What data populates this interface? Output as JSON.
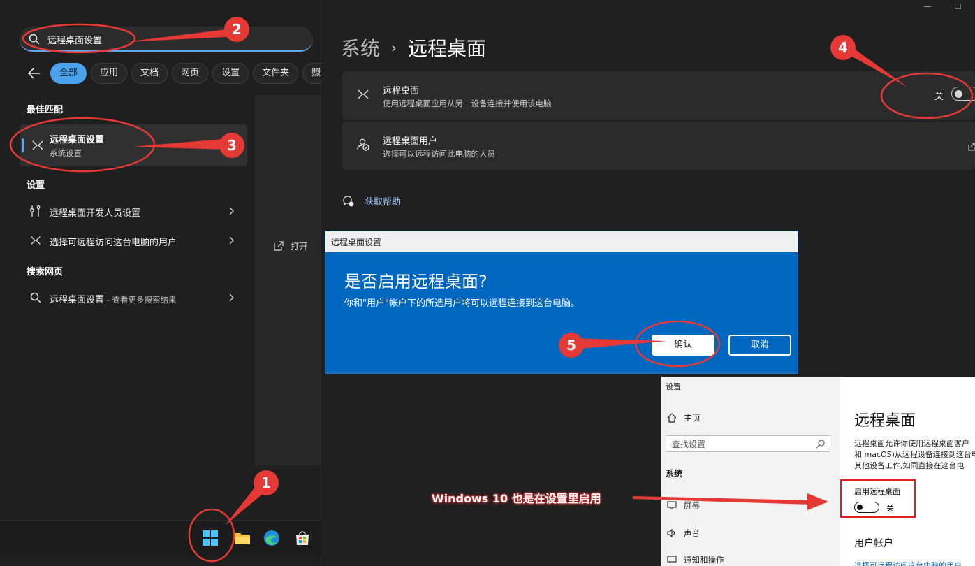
{
  "search": {
    "query": "远程桌面设置",
    "back_label": "返回",
    "filters": [
      "全部",
      "应用",
      "文档",
      "网页",
      "设置",
      "文件夹",
      "照片"
    ],
    "best_match_heading": "最佳匹配",
    "best_match": {
      "title": "远程桌面设置",
      "subtitle": "系统设置"
    },
    "settings_heading": "设置",
    "settings_items": [
      "远程桌面开发人员设置",
      "选择可远程访问这台电脑的用户"
    ],
    "web_heading": "搜索网页",
    "web_item": {
      "title": "远程桌面设置",
      "suffix": " - 查看更多搜索结果"
    },
    "open_label": "打开"
  },
  "settings": {
    "breadcrumb_parent": "系统",
    "breadcrumb_sep": "›",
    "breadcrumb_current": "远程桌面",
    "win_minimize": "—",
    "win_maximize": "☐",
    "remote_desktop": {
      "title": "远程桌面",
      "desc": "使用远程桌面应用从另一设备连接并使用该电脑",
      "state_label": "关",
      "enabled": false
    },
    "remote_users": {
      "title": "远程桌面用户",
      "desc": "选择可以远程访问此电脑的人员"
    },
    "help_label": "获取帮助"
  },
  "dialog": {
    "title": "远程桌面设置",
    "heading": "是否启用远程桌面?",
    "body": "你和\"用户\"帐户下的所选用户将可以远程连接到这台电脑。",
    "confirm_label": "确认",
    "cancel_label": "取消"
  },
  "win10": {
    "window_title": "设置",
    "home": "主页",
    "search_placeholder": "查找设置",
    "system_heading": "系统",
    "nav": [
      "屏幕",
      "声音",
      "通知和操作"
    ],
    "heading": "远程桌面",
    "desc_lines": [
      "远程桌面允许你使用远程桌面客户",
      "和 macOS)从远程设备连接到这台电",
      "其他设备工作,如同直接在这台电"
    ],
    "enable_label": "启用远程桌面",
    "state_label": "关",
    "users_heading": "用户帐户",
    "users_link": "选择可远程访问这台电脑的用户"
  },
  "annotations": {
    "steps": [
      "1",
      "2",
      "3",
      "4",
      "5"
    ],
    "win10_note": "Windows 10 也是在设置里启用",
    "color": "#e53935"
  },
  "colors": {
    "accent": "#4aa3ec",
    "dialog_blue": "#0067c0",
    "dark_bg": "#202020"
  }
}
